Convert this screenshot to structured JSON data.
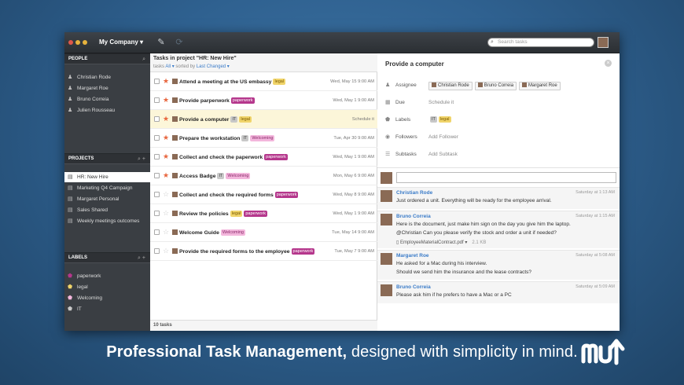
{
  "app": {
    "company": "My Company",
    "search_placeholder": "Search tasks"
  },
  "sidebar": {
    "people_header": "PEOPLE",
    "people": [
      "Christian Rode",
      "Margaret Roe",
      "Bruno Correia",
      "Julien Rousseau"
    ],
    "projects_header": "PROJECTS",
    "projects": [
      "HR: New Hire",
      "Marketing Q4 Campaign",
      "Margaret Personal",
      "Sales Shared",
      "Weekly meetings outcomes"
    ],
    "labels_header": "LABELS",
    "labels": [
      {
        "name": "paperwork",
        "color": "#b5378c"
      },
      {
        "name": "legal",
        "color": "#f0d46a"
      },
      {
        "name": "Welcoming",
        "color": "#f3b6dc"
      },
      {
        "name": "IT",
        "color": "#c8c8c8"
      }
    ]
  },
  "tasks": {
    "title": "Tasks in project \"HR: New Hire\"",
    "sub_prefix": "tasks",
    "filter": "All ▾",
    "sorted_by": "sorted by",
    "sort": "Last Changed ▾",
    "items": [
      {
        "name": "Attend a meeting at the US embassy",
        "tags": [
          {
            "t": "legal",
            "c": "t-lg"
          }
        ],
        "date": "Wed, May 15 9:00 AM",
        "starred": true
      },
      {
        "name": "Provide parperwork",
        "tags": [
          {
            "t": "paperwork",
            "c": "t-pw"
          }
        ],
        "date": "Wed, May 1 9:00 AM",
        "starred": true
      },
      {
        "name": "Provide a computer",
        "tags": [
          {
            "t": "IT",
            "c": "t-it"
          },
          {
            "t": "legal",
            "c": "t-lg"
          }
        ],
        "date": "Schedule it",
        "starred": true
      },
      {
        "name": "Prepare the workstation",
        "tags": [
          {
            "t": "IT",
            "c": "t-it"
          },
          {
            "t": "Welcoming",
            "c": "t-wc"
          }
        ],
        "date": "Tue, Apr 30 9:00 AM",
        "starred": true
      },
      {
        "name": "Collect and check the paperwork",
        "tags": [
          {
            "t": "paperwork",
            "c": "t-pw"
          }
        ],
        "date": "Wed, May 1 9:00 AM",
        "starred": true
      },
      {
        "name": "Access Badge",
        "tags": [
          {
            "t": "IT",
            "c": "t-it"
          },
          {
            "t": "Welcoming",
            "c": "t-wc"
          }
        ],
        "date": "Mon, May 6 9:00 AM",
        "starred": true
      },
      {
        "name": "Collect and check the required forms",
        "tags": [
          {
            "t": "paperwork",
            "c": "t-pw"
          }
        ],
        "date": "Wed, May 8 9:00 AM",
        "starred": false
      },
      {
        "name": "Review the policies",
        "tags": [
          {
            "t": "legal",
            "c": "t-lg"
          },
          {
            "t": "paperwork",
            "c": "t-pw"
          }
        ],
        "date": "Wed, May 1 9:00 AM",
        "starred": false
      },
      {
        "name": "Welcome Guide",
        "tags": [
          {
            "t": "Welcoming",
            "c": "t-wc"
          }
        ],
        "date": "Tue, May 14 9:00 AM",
        "starred": false
      },
      {
        "name": "Provide the required forms to the employee",
        "tags": [
          {
            "t": "paperwork",
            "c": "t-pw"
          }
        ],
        "date": "Tue, May 7 9:00 AM",
        "starred": false
      }
    ],
    "count": "10 tasks"
  },
  "detail": {
    "title": "Provide a computer",
    "assignee_label": "Assignee",
    "assignees": [
      "Christian Rode",
      "Bruno Correia",
      "Margaret Roe"
    ],
    "due_label": "Due",
    "due_value": "Schedule it",
    "labels_label": "Labels",
    "labels": [
      {
        "t": "IT",
        "c": "t-it"
      },
      {
        "t": "legal",
        "c": "t-lg"
      }
    ],
    "followers_label": "Followers",
    "followers_value": "Add Follower",
    "subtasks_label": "Subtasks",
    "subtasks_value": "Add Subtask",
    "comments": [
      {
        "name": "Christian Rode",
        "time": "Saturday at 1:13 AM",
        "lines": [
          "Just ordered a unit. Everything will be ready for the employee arrival."
        ]
      },
      {
        "name": "Bruno Correia",
        "time": "Saturday at 1:15 AM",
        "lines": [
          "Here is the document, just make him sign on the day you give him the laptop.",
          "@Christian Can you please verify the stock and order a unit if needed?"
        ],
        "attachment": "EmployeeMaterialContract.pdf ▾",
        "attach_size": "2.1 KB"
      },
      {
        "name": "Margaret Roe",
        "time": "Saturday at 5:08 AM",
        "lines": [
          "He asked for a Mac during his interview.",
          "Should we send him the insurance and the lease contracts?"
        ]
      },
      {
        "name": "Bruno Correia",
        "time": "Saturday at 5:09 AM",
        "lines": [
          "Please ask him if he prefers to have a Mac or a PC"
        ]
      }
    ]
  },
  "tagline": {
    "bold": "Professional Task Management,",
    "rest": " designed with simplicity in mind."
  }
}
